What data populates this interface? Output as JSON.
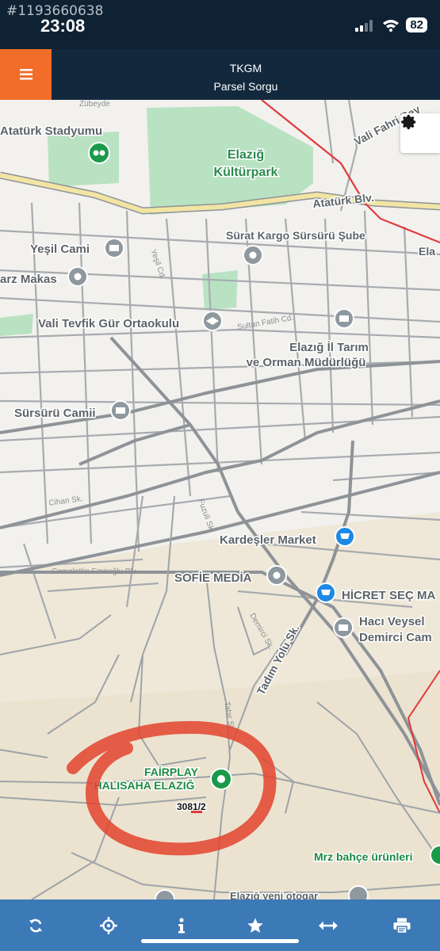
{
  "status_bar": {
    "watermark": "#1193660638",
    "time": "23:08",
    "battery": "82"
  },
  "header": {
    "title": "TKGM",
    "subtitle": "Parsel Sorgu"
  },
  "map": {
    "places": {
      "stadium": "Atatürk Stadyumu",
      "park_line1": "Elazığ",
      "park_line2": "Kültürpark",
      "ataturk_blv": "Atatürk Blv.",
      "vali_fahri": "Vali Fahri Bey",
      "yesil_cami": "Yeşil Cami",
      "surat_kargo": "Sürat Kargo Sürsürü Şube",
      "makas": "arz Makas",
      "ela": "Ela",
      "vali_tevfik": "Vali Tevfik Gür Ortaokulu",
      "sultan": "Sultan Fatih Cd.",
      "tarim_line1": "Elazığ İl Tarım",
      "tarim_line2": "ve Orman Müdürlüğü",
      "sursuru_camii": "Sürsürü Camii",
      "kardesler": "Kardeşler Market",
      "sofie": "SOFİE MEDİA",
      "hicret": "HİCRET SEÇ MA",
      "haci_line1": "Hacı Veysel",
      "haci_line2": "Demirci Cam",
      "tadim": "Tadım Yolu Sk.",
      "fairplay_line1": "FAİRPLAY",
      "fairplay_line2": "HALISAHA ELAZIĞ",
      "mrz": "Mrz bahçe ürünleri",
      "otogar": "Elazığ yeni otogar",
      "zubeyde": "Zübeyde",
      "cemalettin": "Cemalettin Emiroğlu Blv.",
      "cihan": "Cihan Sk.",
      "tahir": "Tahir Sk.",
      "demirci": "Demirci Sk.",
      "fuzuli": "Fuzuli Sk.",
      "yesil_cd": "Yeşil Cd."
    },
    "parcel_label": "3081/2",
    "colors": {
      "park": "#b9e2c3",
      "road_main": "#9ea3a8",
      "highway": "#f2e4a3",
      "red_line": "#e0393b",
      "marker_gray": "#8f989f",
      "marker_blue": "#1e88e5",
      "marker_green": "#1a9a4a",
      "annotation": "#e3432e"
    }
  },
  "settings": {
    "icon": "gear-icon"
  },
  "toolbar": {
    "buttons": [
      {
        "name": "refresh-icon"
      },
      {
        "name": "locate-icon"
      },
      {
        "name": "info-icon"
      },
      {
        "name": "star-icon"
      },
      {
        "name": "measure-icon"
      },
      {
        "name": "print-icon"
      }
    ]
  }
}
